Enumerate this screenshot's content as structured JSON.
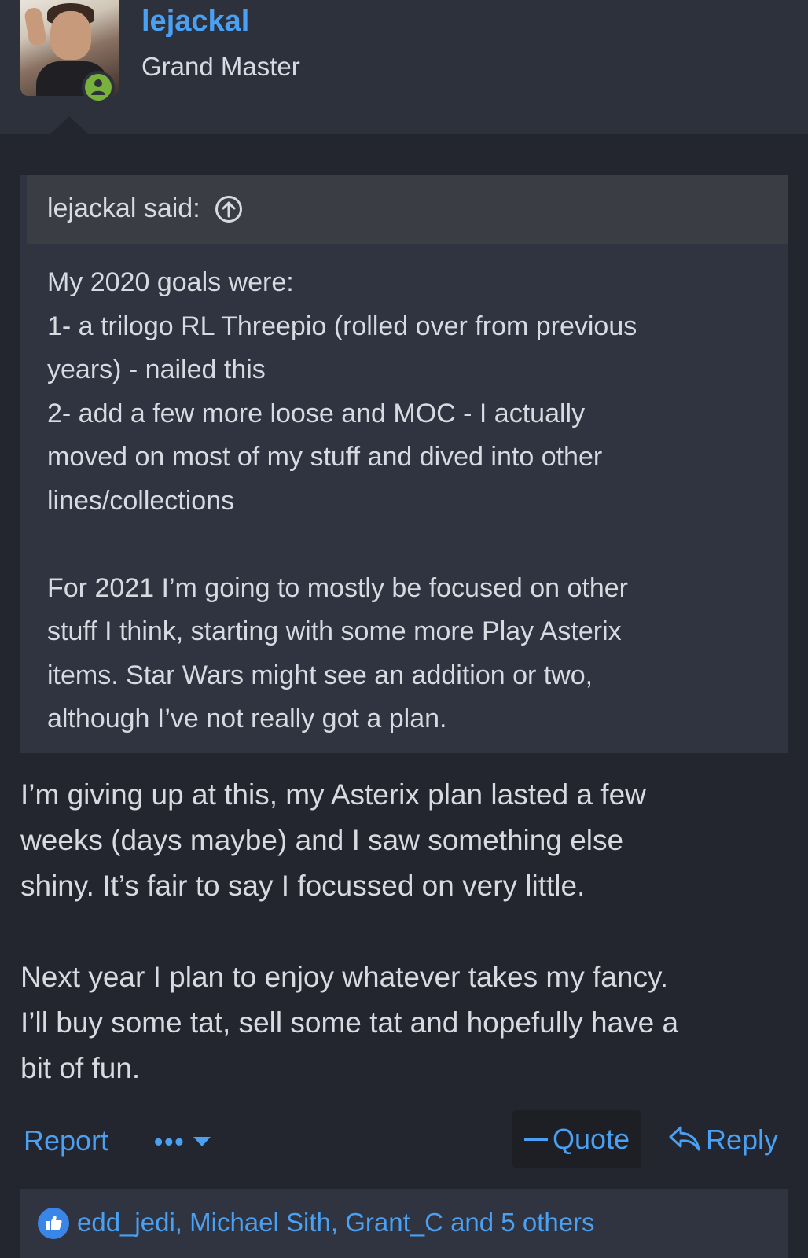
{
  "author": {
    "username": "lejackal",
    "title": "Grand Master",
    "avatar_alt": "avatar",
    "status_icon": "online-user-icon"
  },
  "quote": {
    "attribution": "lejackal said:",
    "jump_icon": "arrow-up-circle-icon",
    "lines": [
      "My 2020 goals were:",
      "1- a trilogo RL Threepio (rolled over from previous",
      "years) - nailed this",
      "2- add a few more loose and MOC - I actually",
      "moved on most of my stuff and dived into other",
      "lines/collections"
    ],
    "lines2": [
      "For 2021 I’m going to mostly be focused on other",
      "stuff I think, starting with some more Play Asterix",
      "items. Star Wars might see an addition or two,",
      "although I’ve not really got a plan."
    ]
  },
  "reply": {
    "para1": [
      "I’m giving up at this, my Asterix plan lasted a few",
      "weeks (days maybe) and I saw something else",
      "shiny. It’s fair to say I focussed on very little."
    ],
    "para2": [
      "Next year I plan to enjoy whatever takes my fancy.",
      "I’ll buy some tat, sell some tat and hopefully have a",
      "bit of fun."
    ]
  },
  "actions": {
    "report_label": "Report",
    "more_label": "•••",
    "quote_label": "Quote",
    "reply_label": "Reply"
  },
  "reactions": {
    "icon": "thumbs-up-icon",
    "text": "edd_jedi, Michael Sith, Grant_C and 5 others"
  },
  "colors": {
    "accent": "#4aa0f2",
    "background": "#23262f",
    "header": "#2c313c",
    "quote_bg": "#2f3440",
    "online": "#78b23c"
  }
}
